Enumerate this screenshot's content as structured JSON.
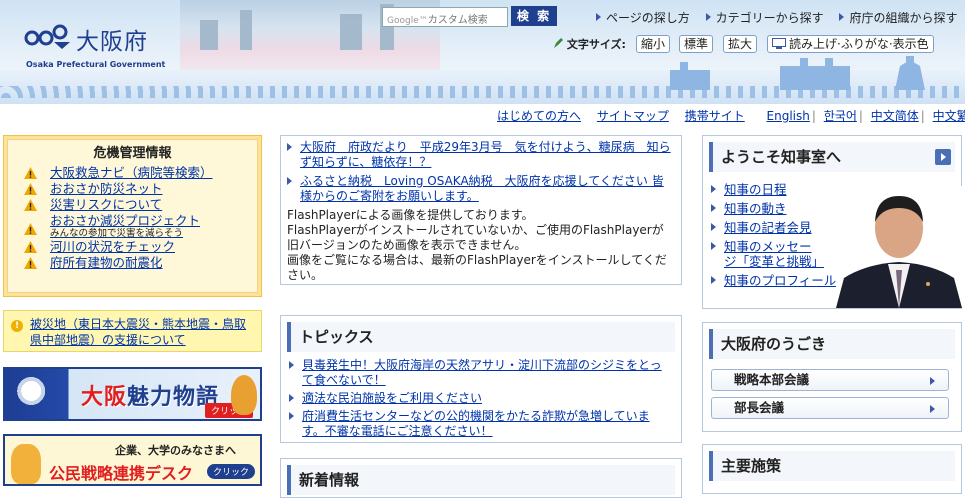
{
  "header": {
    "logo_jp": "大阪府",
    "logo_en": "Osaka Prefectural Government",
    "search_placeholder": "カスタム検索",
    "search_brand": "Google™",
    "search_button": "検 索",
    "top_links": [
      "ページの探し方",
      "カテゴリーから探す",
      "府庁の組織から探す"
    ],
    "font_size_label": "文字サイズ:",
    "font_small": "縮小",
    "font_normal": "標準",
    "font_large": "拡大",
    "read_aloud": "読み上げ·ふりがな·表示色"
  },
  "nav": {
    "links": [
      "はじめての方へ",
      "サイトマップ",
      "携帯サイト"
    ],
    "languages": [
      "English",
      "한국어",
      "中文简体",
      "中文繁體"
    ]
  },
  "crisis": {
    "title": "危機管理情報",
    "items": [
      {
        "label": "大阪救急ナビ（病院等検索）"
      },
      {
        "label": "おおさか防災ネット"
      },
      {
        "label": "災害リスクについて"
      },
      {
        "label": "おおさか減災プロジェクト",
        "sub": "みんなの参加で災害を減らそう"
      },
      {
        "label": "河川の状況をチェック"
      },
      {
        "label": "府所有建物の耐震化"
      }
    ]
  },
  "disaster_support": "被災地（東日本大震災・熊本地震・鳥取県中部地震）の支援について",
  "banners": {
    "miryoku_1": "大阪",
    "miryoku_2": "魅力物語",
    "miryoku_click": "クリック",
    "kousen_sub": "企業、大学のみなさまへ",
    "kousen_main": "公民戦略連携デスク",
    "kousen_click": "クリック"
  },
  "news": {
    "items": [
      "大阪府　府政だより　平成29年3月号　気を付けよう、糖尿病　知らず知らずに、糖依存！？",
      "ふるさと納税　Loving OSAKA納税　大阪府を応援してください 皆様からのご寄附をお願いします。"
    ],
    "flash_lines": [
      "FlashPlayerによる画像を提供しております。",
      "FlashPlayerがインストールされていないか、ご使用のFlashPlayerが旧バージョンのため画像を表示できません。",
      "画像をご覧になる場合は、最新のFlashPlayerをインストールしてください。"
    ]
  },
  "topics": {
    "title": "トピックス",
    "items": [
      "貝毒発生中！大阪府海岸の天然アサリ・淀川下流部のシジミをとって食べないで！",
      "適法な民泊施設をご利用ください",
      "府消費生活センターなどの公的機関をかたる詐欺が急増しています。不審な電話にご注意ください！"
    ]
  },
  "new_info": {
    "title": "新着情報"
  },
  "governor": {
    "title": "ようこそ知事室へ",
    "items": [
      "知事の日程",
      "知事の動き",
      "知事の記者会見",
      "知事のメッセージ「変革と挑戦」",
      "知事のプロフィール"
    ]
  },
  "ugoki": {
    "title": "大阪府のうごき",
    "buttons": [
      "戦略本部会議",
      "部長会議"
    ]
  },
  "shuyo": {
    "title": "主要施策"
  },
  "colors": {
    "brand": "#1f3f8f",
    "link": "#0033aa",
    "crisis_bg": "#fde39a",
    "panel_border": "#b6c8df"
  }
}
